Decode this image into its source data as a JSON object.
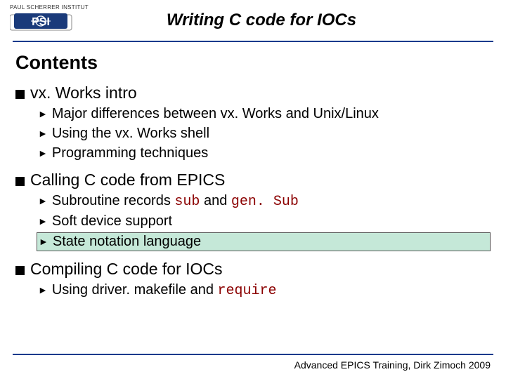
{
  "logo": {
    "topline": "PAUL SCHERRER INSTITUT",
    "abbr": "PSI"
  },
  "title": "Writing C code for IOCs",
  "contents_label": "Contents",
  "sections": [
    {
      "heading": "vx. Works intro",
      "items": [
        {
          "text": "Major differences between vx. Works and Unix/Linux",
          "highlight": false
        },
        {
          "text": "Using the vx. Works shell",
          "highlight": false
        },
        {
          "text": "Programming techniques",
          "highlight": false
        }
      ]
    },
    {
      "heading": "Calling C code from EPICS",
      "items": [
        {
          "prefix": "Subroutine records ",
          "code1": "sub",
          "mid": " and ",
          "code2": "gen. Sub",
          "highlight": false
        },
        {
          "text": "Soft device support",
          "highlight": false
        },
        {
          "text": "State notation language",
          "highlight": true
        }
      ]
    },
    {
      "heading": "Compiling C code for IOCs",
      "items": [
        {
          "prefix": "Using driver. makefile and ",
          "code1": "require",
          "highlight": false
        }
      ]
    }
  ],
  "footer": "Advanced EPICS Training, Dirk Zimoch 2009"
}
